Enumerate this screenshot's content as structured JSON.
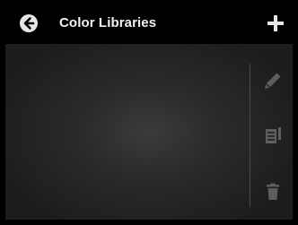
{
  "header": {
    "title": "Color Libraries",
    "back_icon": "back-arrow-icon",
    "add_icon": "plus-icon"
  },
  "toolbar": {
    "edit_icon": "pencil-icon",
    "duplicate_icon": "duplicate-icon",
    "delete_icon": "trash-icon"
  },
  "colors": {
    "header_bg": "#000000",
    "text": "#f2f2f2",
    "icon_active": "#e6e6e6",
    "icon_disabled": "#5e5e5e",
    "content_bg": "#2a2a2a"
  }
}
